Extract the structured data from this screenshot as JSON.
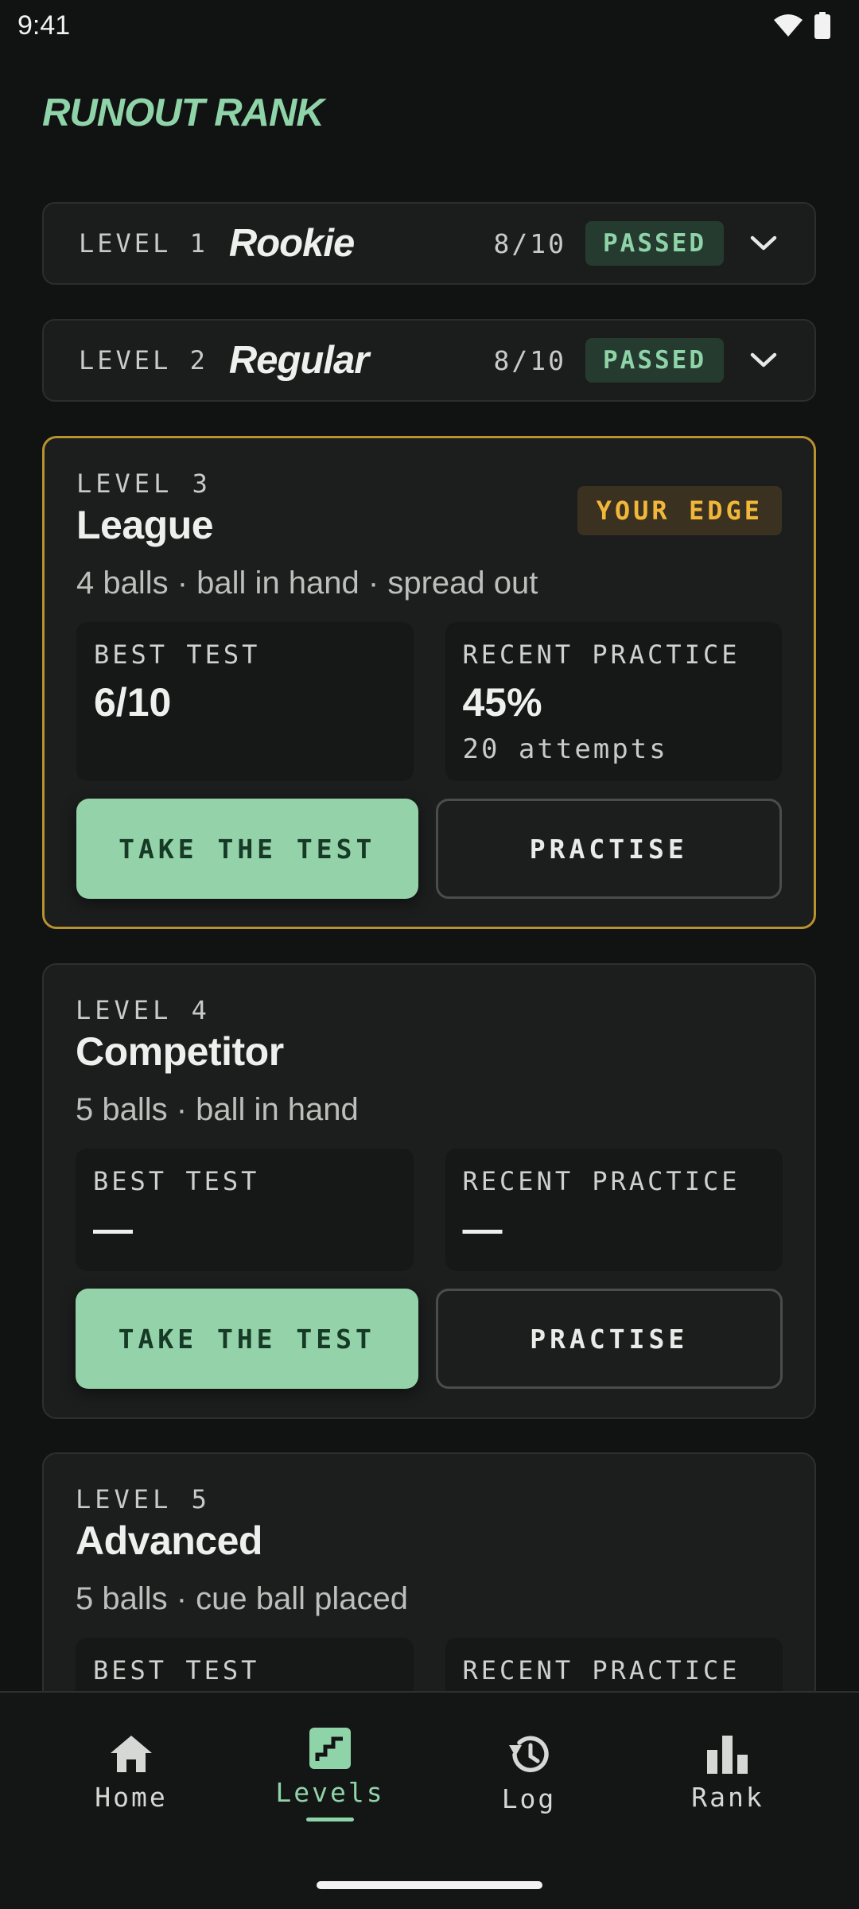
{
  "status": {
    "time": "9:41"
  },
  "header": {
    "title": "RUNOUT RANK"
  },
  "levels_collapsed": [
    {
      "label": "LEVEL 1",
      "name": "Rookie",
      "score": "8/10",
      "status": "PASSED"
    },
    {
      "label": "LEVEL 2",
      "name": "Regular",
      "score": "8/10",
      "status": "PASSED"
    }
  ],
  "level3": {
    "label": "LEVEL 3",
    "name": "League",
    "badge": "YOUR EDGE",
    "desc": "4 balls · ball in hand · spread out",
    "best_label": "BEST TEST",
    "best_value": "6/10",
    "recent_label": "RECENT PRACTICE",
    "recent_value": "45%",
    "recent_sub": "20 attempts",
    "primary_btn": "TAKE THE TEST",
    "secondary_btn": "PRACTISE"
  },
  "level4": {
    "label": "LEVEL 4",
    "name": "Competitor",
    "desc": "5 balls · ball in hand",
    "best_label": "BEST TEST",
    "best_value": "—",
    "recent_label": "RECENT PRACTICE",
    "recent_value": "—",
    "primary_btn": "TAKE THE TEST",
    "secondary_btn": "PRACTISE"
  },
  "level5": {
    "label": "LEVEL 5",
    "name": "Advanced",
    "desc": "5 balls · cue ball placed",
    "best_label": "BEST TEST",
    "recent_label": "RECENT PRACTICE"
  },
  "nav": {
    "items": [
      {
        "label": "Home",
        "icon": "home-icon"
      },
      {
        "label": "Levels",
        "icon": "levels-icon"
      },
      {
        "label": "Log",
        "icon": "history-icon"
      },
      {
        "label": "Rank",
        "icon": "bar-chart-icon"
      }
    ],
    "active": "Levels"
  },
  "colors": {
    "accent": "#8fd3a8",
    "edge": "#f1b73a",
    "background": "#111212"
  }
}
